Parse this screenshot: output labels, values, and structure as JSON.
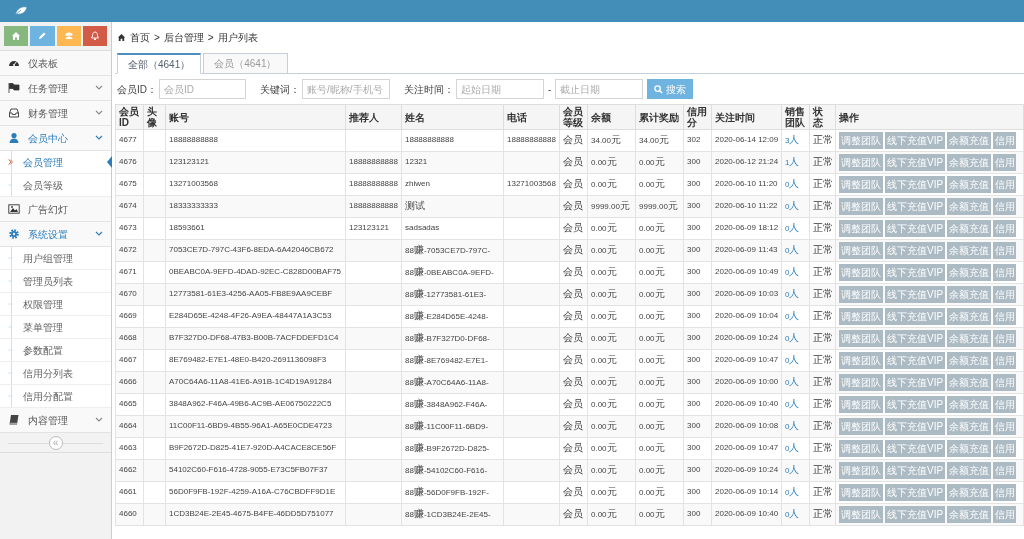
{
  "sidebar": {
    "shortcuts": [
      {
        "color": "#87b87f"
      },
      {
        "color": "#6fb3e0"
      },
      {
        "color": "#ffb752"
      },
      {
        "color": "#d15b47"
      }
    ],
    "menu": [
      {
        "label": "仪表板"
      },
      {
        "label": "任务管理",
        "expanded": false
      },
      {
        "label": "财务管理",
        "expanded": false
      },
      {
        "label": "会员中心",
        "expanded": true,
        "children": [
          {
            "label": "会员管理",
            "selected": true
          },
          {
            "label": "会员等级",
            "selected": false
          }
        ]
      },
      {
        "label": "广告幻灯"
      },
      {
        "label": "系统设置",
        "expanded": true,
        "children": [
          {
            "label": "用户组管理",
            "selected": false
          },
          {
            "label": "管理员列表",
            "selected": false
          },
          {
            "label": "权限管理",
            "selected": false
          },
          {
            "label": "菜单管理",
            "selected": false
          },
          {
            "label": "参数配置",
            "selected": false
          },
          {
            "label": "信用分列表",
            "selected": false
          },
          {
            "label": "信用分配置",
            "selected": false
          }
        ]
      },
      {
        "label": "内容管理",
        "expanded": false
      }
    ],
    "collapse": "«"
  },
  "breadcrumb": {
    "items": [
      "首页",
      "后台管理",
      "用户列表"
    ],
    "separator": ">"
  },
  "tabs": [
    {
      "label": "全部（4641）",
      "selected": true
    },
    {
      "label": "会员（4641）",
      "selected": false
    }
  ],
  "filters": [
    {
      "label": "会员ID：",
      "placeholder": "会员ID"
    },
    {
      "label": "关键词：",
      "placeholder": "账号/昵称/手机号"
    },
    {
      "label": "关注时间：",
      "placeholder": "起始日期"
    },
    {
      "label": "-",
      "placeholder": "截止日期"
    }
  ],
  "search_button": "搜索",
  "table": {
    "columns": [
      "会员ID",
      "头像",
      "账号",
      "推荐人",
      "姓名",
      "电话",
      "会员等级",
      "余额",
      "累计奖励",
      "信用分",
      "关注时间",
      "销售团队",
      "状态",
      "操作"
    ],
    "rows": [
      {
        "id": "4677",
        "account": "18888888888",
        "name": "18888888888",
        "phone": "18888888888",
        "level": "会员",
        "balance": "34.00元",
        "reward": "34.00元",
        "credit": "302",
        "time": "2020-06-14 12:09",
        "team": "3人",
        "status": "正常",
        "actions": [
          "调整团队",
          "线下充值VIP",
          "余额充值",
          "信用"
        ]
      },
      {
        "id": "4676",
        "account": "123123121",
        "referrer": "18888888888",
        "name": "12321",
        "level": "会员",
        "balance": "0.00元",
        "reward": "0.00元",
        "credit": "300",
        "time": "2020-06-12 21:24",
        "team": "1人",
        "status": "正常",
        "actions": [
          "调整团队",
          "线下充值VIP",
          "余额充值",
          "信用"
        ]
      },
      {
        "id": "4675",
        "account": "13271003568",
        "referrer": "18888888888",
        "name": "zhiwen",
        "phone": "13271003568",
        "level": "会员",
        "balance": "0.00元",
        "reward": "0.00元",
        "credit": "300",
        "time": "2020-06-10 11:20",
        "team": "0人",
        "status": "正常",
        "actions": [
          "调整团队",
          "线下充值VIP",
          "余额充值",
          "信用"
        ]
      },
      {
        "id": "4674",
        "account": "18333333333",
        "referrer": "18888888888",
        "name": "测试",
        "level": "会员",
        "balance": "9999.00元",
        "reward": "9999.00元",
        "credit": "300",
        "time": "2020-06-10 11:22",
        "team": "0人",
        "status": "正常",
        "actions": [
          "调整团队",
          "线下充值VIP",
          "余额充值",
          "信用"
        ]
      },
      {
        "id": "4673",
        "account": "18593661",
        "referrer": "123123121",
        "name": "sadsadas",
        "level": "会员",
        "balance": "0.00元",
        "reward": "0.00元",
        "credit": "300",
        "time": "2020-06-09 18:12",
        "team": "0人",
        "status": "正常",
        "actions": [
          "调整团队",
          "线下充值VIP",
          "余额充值",
          "信用"
        ]
      },
      {
        "id": "4672",
        "account": "7053CE7D-797C-43F6-8EDA-6A42046CB672",
        "name": "88赚-7053CE7D-797C-",
        "level": "会员",
        "balance": "0.00元",
        "reward": "0.00元",
        "credit": "300",
        "time": "2020-06-09 11:43",
        "team": "0人",
        "status": "正常",
        "actions": [
          "调整团队",
          "线下充值VIP",
          "余额充值",
          "信用"
        ]
      },
      {
        "id": "4671",
        "account": "0BEABC0A-9EFD-4DAD-92EC-C828D00BAF75",
        "name": "88赚-0BEABC0A-9EFD-",
        "level": "会员",
        "balance": "0.00元",
        "reward": "0.00元",
        "credit": "300",
        "time": "2020-06-09 10:49",
        "team": "0人",
        "status": "正常",
        "actions": [
          "调整团队",
          "线下充值VIP",
          "余额充值",
          "信用"
        ]
      },
      {
        "id": "4670",
        "account": "12773581-61E3-4256-AA05-FB8E9AA9CEBF",
        "name": "88赚-12773581-61E3-",
        "level": "会员",
        "balance": "0.00元",
        "reward": "0.00元",
        "credit": "300",
        "time": "2020-06-09 10:03",
        "team": "0人",
        "status": "正常",
        "actions": [
          "调整团队",
          "线下充值VIP",
          "余额充值",
          "信用"
        ]
      },
      {
        "id": "4669",
        "account": "E284D65E-4248-4F26-A9EA-48447A1A3C53",
        "name": "88赚-E284D65E-4248-",
        "level": "会员",
        "balance": "0.00元",
        "reward": "0.00元",
        "credit": "300",
        "time": "2020-06-09 10:04",
        "team": "0人",
        "status": "正常",
        "actions": [
          "调整团队",
          "线下充值VIP",
          "余额充值",
          "信用"
        ]
      },
      {
        "id": "4668",
        "account": "B7F327D0-DF68-47B3-B00B-7ACFDDEFD1C4",
        "name": "88赚-B7F327D0-DF68-",
        "level": "会员",
        "balance": "0.00元",
        "reward": "0.00元",
        "credit": "300",
        "time": "2020-06-09 10:24",
        "team": "0人",
        "status": "正常",
        "actions": [
          "调整团队",
          "线下充值VIP",
          "余额充值",
          "信用"
        ]
      },
      {
        "id": "4667",
        "account": "8E769482-E7E1-48E0-B420-2691136098F3",
        "name": "88赚-8E769482-E7E1-",
        "level": "会员",
        "balance": "0.00元",
        "reward": "0.00元",
        "credit": "300",
        "time": "2020-06-09 10:47",
        "team": "0人",
        "status": "正常",
        "actions": [
          "调整团队",
          "线下充值VIP",
          "余额充值",
          "信用"
        ]
      },
      {
        "id": "4666",
        "account": "A70C64A6-11A8-41E6-A91B-1C4D19A91284",
        "name": "88赚-A70C64A6-11A8-",
        "level": "会员",
        "balance": "0.00元",
        "reward": "0.00元",
        "credit": "300",
        "time": "2020-06-09 10:00",
        "team": "0人",
        "status": "正常",
        "actions": [
          "调整团队",
          "线下充值VIP",
          "余额充值",
          "信用"
        ]
      },
      {
        "id": "4665",
        "account": "3848A962-F46A-49B6-AC9B-AE06750222C5",
        "name": "88赚-3848A962-F46A-",
        "level": "会员",
        "balance": "0.00元",
        "reward": "0.00元",
        "credit": "300",
        "time": "2020-06-09 10:40",
        "team": "0人",
        "status": "正常",
        "actions": [
          "调整团队",
          "线下充值VIP",
          "余额充值",
          "信用"
        ]
      },
      {
        "id": "4664",
        "account": "11C00F11-6BD9-4B55-96A1-A65E0CDE4723",
        "name": "88赚-11C00F11-6BD9-",
        "level": "会员",
        "balance": "0.00元",
        "reward": "0.00元",
        "credit": "300",
        "time": "2020-06-09 10:08",
        "team": "0人",
        "status": "正常",
        "actions": [
          "调整团队",
          "线下充值VIP",
          "余额充值",
          "信用"
        ]
      },
      {
        "id": "4663",
        "account": "B9F2672D-D825-41E7-920D-A4CACE8CE56F",
        "name": "88赚-B9F2672D-D825-",
        "level": "会员",
        "balance": "0.00元",
        "reward": "0.00元",
        "credit": "300",
        "time": "2020-06-09 10:47",
        "team": "0人",
        "status": "正常",
        "actions": [
          "调整团队",
          "线下充值VIP",
          "余额充值",
          "信用"
        ]
      },
      {
        "id": "4662",
        "account": "54102C60-F616-4728-9055-E73C5FB07F37",
        "name": "88赚-54102C60-F616-",
        "level": "会员",
        "balance": "0.00元",
        "reward": "0.00元",
        "credit": "300",
        "time": "2020-06-09 10:24",
        "team": "0人",
        "status": "正常",
        "actions": [
          "调整团队",
          "线下充值VIP",
          "余额充值",
          "信用"
        ]
      },
      {
        "id": "4661",
        "account": "56D0F9FB-192F-4259-A16A-C76CBDFF9D1E",
        "name": "88赚-56D0F9FB-192F-",
        "level": "会员",
        "balance": "0.00元",
        "reward": "0.00元",
        "credit": "300",
        "time": "2020-06-09 10:14",
        "team": "0人",
        "status": "正常",
        "actions": [
          "调整团队",
          "线下充值VIP",
          "余额充值",
          "信用"
        ]
      },
      {
        "id": "4660",
        "account": "1CD3B24E-2E45-4675-B4FE-46DD5D751077",
        "name": "88赚-1CD3B24E-2E45-",
        "level": "会员",
        "balance": "0.00元",
        "reward": "0.00元",
        "credit": "300",
        "time": "2020-06-09 10:40",
        "team": "0人",
        "status": "正常",
        "actions": [
          "调整团队",
          "线下充值VIP",
          "余额充值",
          "信用"
        ]
      }
    ]
  }
}
